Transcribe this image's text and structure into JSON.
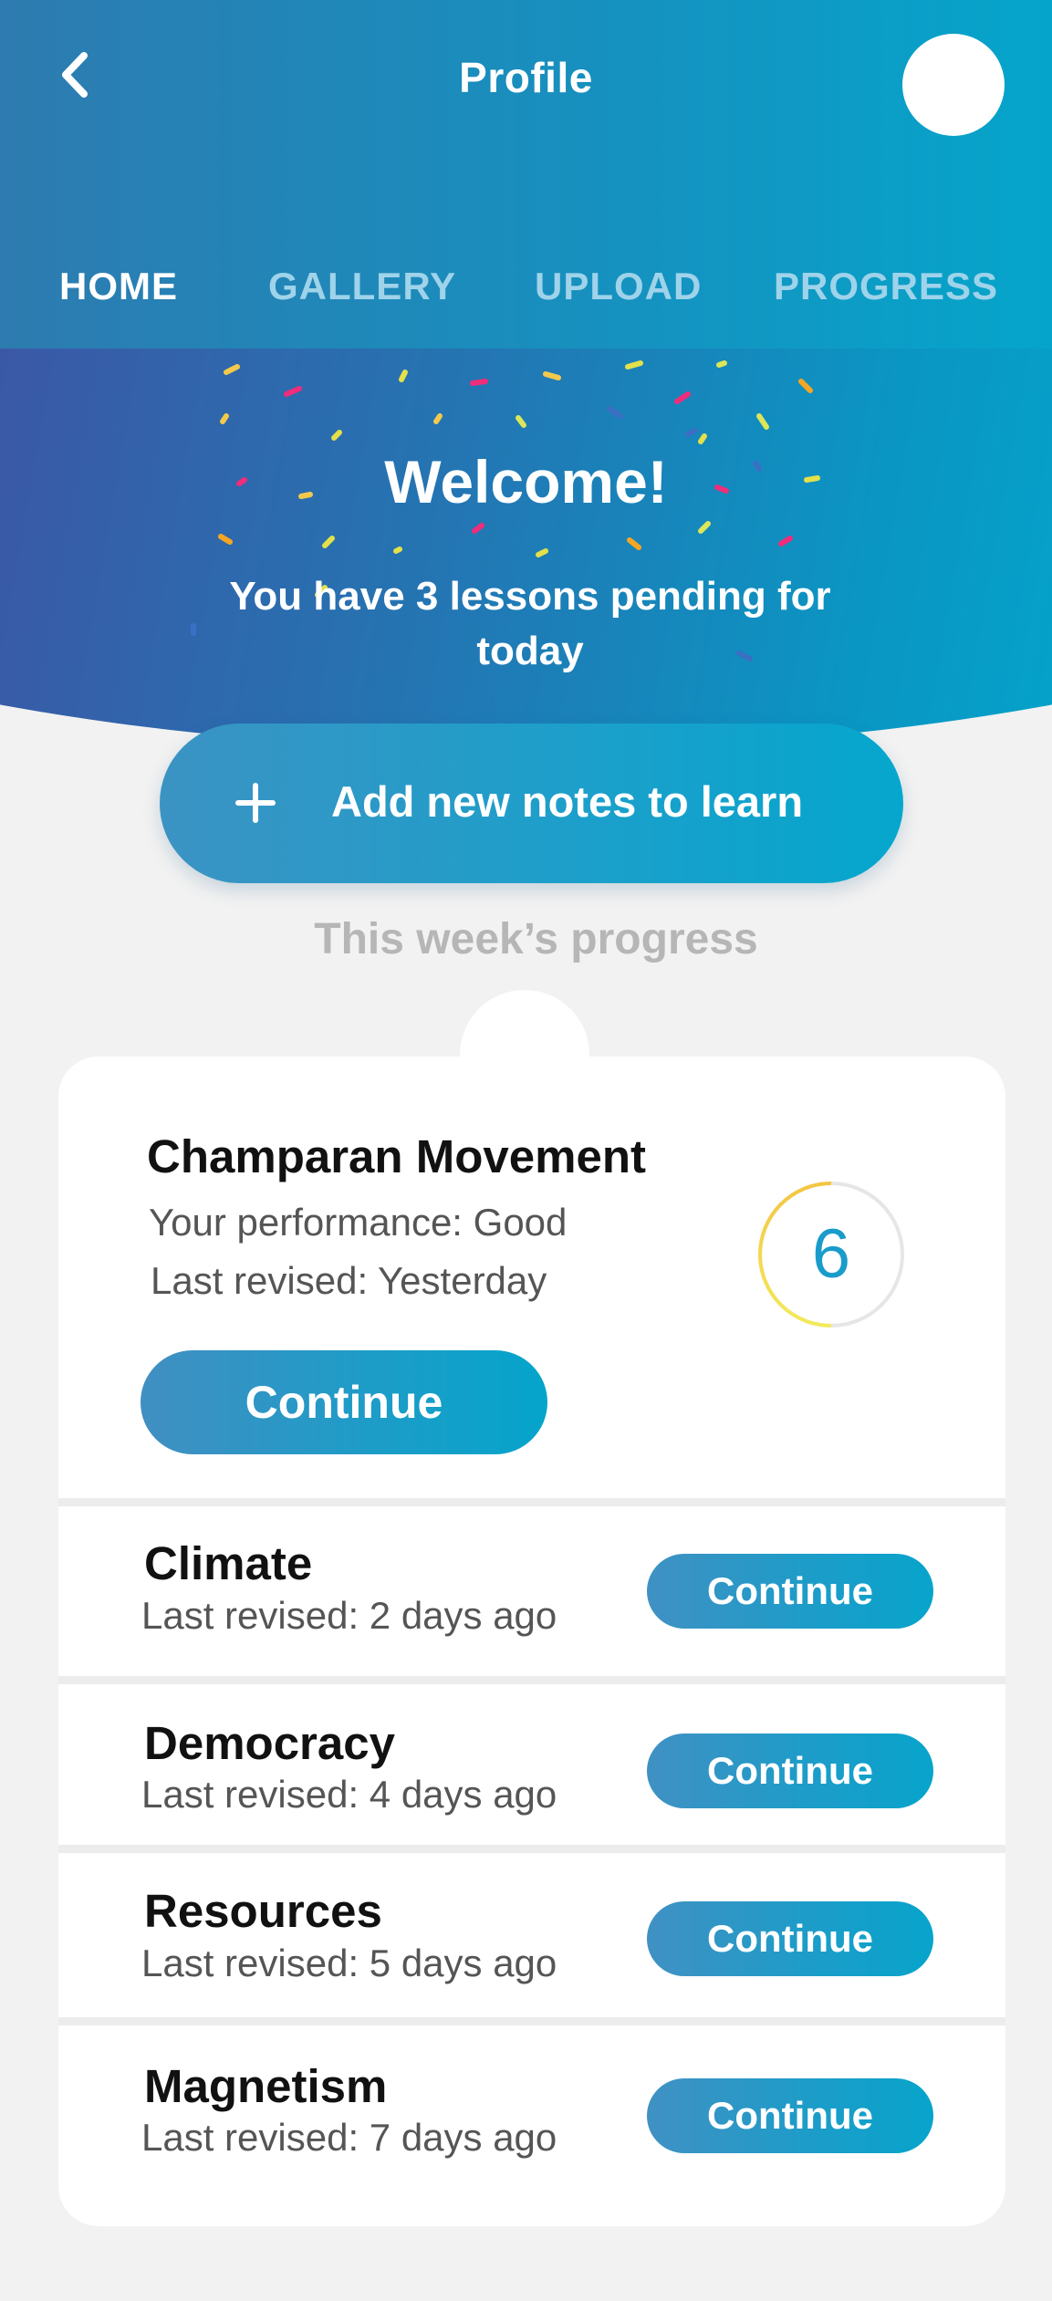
{
  "header": {
    "title": "Profile",
    "back_icon": "chevron-left-icon",
    "avatar_color": "#ffffff",
    "tabs": [
      {
        "label": "HOME",
        "active": true
      },
      {
        "label": "GALLERY",
        "active": false
      },
      {
        "label": "UPLOAD",
        "active": false
      },
      {
        "label": "PROGRESS",
        "active": false
      }
    ]
  },
  "hero": {
    "welcome": "Welcome!",
    "pending_text": "You have 3 lessons pending for today",
    "add_button_label": "Add new notes to learn",
    "add_icon": "plus-icon"
  },
  "progress": {
    "heading": "This week’s progress",
    "featured": {
      "title": "Champaran Movement",
      "performance": "Your performance: Good",
      "last_revised": "Last revised: Yesterday",
      "button_label": "Continue",
      "score": "6"
    },
    "items": [
      {
        "title": "Climate",
        "last_revised": "Last revised: 2 days ago",
        "button_label": "Continue"
      },
      {
        "title": "Democracy",
        "last_revised": "Last revised: 4 days ago",
        "button_label": "Continue"
      },
      {
        "title": "Resources",
        "last_revised": "Last revised: 5 days ago",
        "button_label": "Continue"
      },
      {
        "title": "Magnetism",
        "last_revised": "Last revised: 7 days ago",
        "button_label": "Continue"
      }
    ]
  },
  "colors": {
    "brand_blue": "#1a9ccb",
    "header_gradient_start": "#2d7bb0",
    "header_gradient_end": "#05a5cb",
    "hero_gradient_start": "#3b58a6",
    "confetti": [
      "#f2c94c",
      "#ef2d7a",
      "#e3e04a",
      "#f5a623",
      "#3b6fc4",
      "#dbe65a"
    ]
  }
}
